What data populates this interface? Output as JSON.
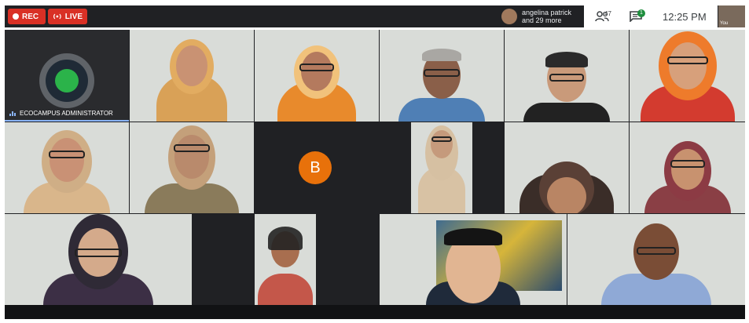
{
  "topbar": {
    "rec_label": "REC",
    "live_label": "LIVE",
    "participants_text_line1": "angelina patrick",
    "participants_text_line2": "and 29 more",
    "people_count": "47",
    "chat_badge": "1",
    "time": "12:25 PM",
    "self_label": "You"
  },
  "tiles": {
    "admin_name": "ECOCAMPUS ADMINISTRATOR",
    "initial": "B"
  },
  "colors": {
    "rec_red": "#d93025",
    "accent_orange": "#e8710a",
    "chat_green": "#1e8e3e",
    "active_blue": "#8ab4f8",
    "dark_bg": "#202124"
  },
  "icons": {
    "rec": "record-dot-icon",
    "live": "broadcast-icon",
    "people": "people-icon",
    "chat": "chat-icon",
    "audio": "audio-level-icon"
  }
}
